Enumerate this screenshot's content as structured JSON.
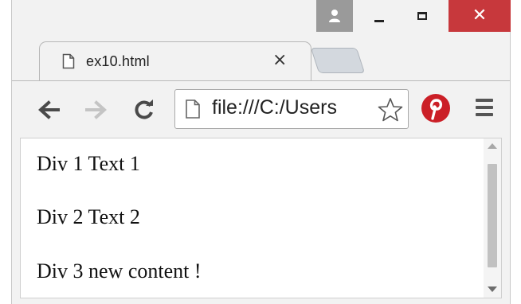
{
  "tab": {
    "title": "ex10.html",
    "close_glyph": "×"
  },
  "window_controls": {
    "user_icon": "user-icon",
    "close_glyph": "✕",
    "close_color": "#c7383c"
  },
  "toolbar": {
    "back_icon": "arrow-left-icon",
    "forward_icon": "arrow-right-icon",
    "reload_icon": "reload-icon",
    "address": "file:///C:/Users",
    "star_icon": "star-icon",
    "extension_icon": "pinterest-icon",
    "extension_color": "#cb1f27",
    "menu_icon": "hamburger-menu-icon"
  },
  "content": {
    "lines": [
      "Div 1 Text 1",
      "Div 2 Text 2",
      "Div 3 new content !"
    ]
  }
}
